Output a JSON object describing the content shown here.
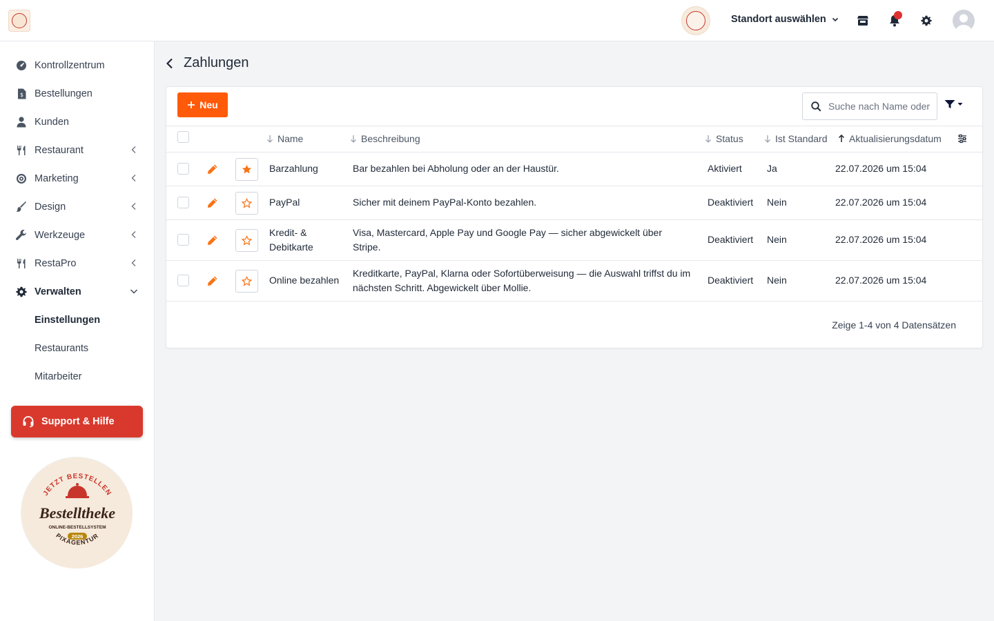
{
  "topbar": {
    "location_label": "Standort auswählen"
  },
  "sidebar": {
    "items": [
      {
        "label": "Kontrollzentrum",
        "icon": "dashboard-icon"
      },
      {
        "label": "Bestellungen",
        "icon": "invoice-icon"
      },
      {
        "label": "Kunden",
        "icon": "user-icon"
      },
      {
        "label": "Restaurant",
        "icon": "utensils-icon"
      },
      {
        "label": "Marketing",
        "icon": "target-icon"
      },
      {
        "label": "Design",
        "icon": "brush-icon"
      },
      {
        "label": "Werkzeuge",
        "icon": "wrench-icon"
      },
      {
        "label": "RestaPro",
        "icon": "utensils-icon"
      },
      {
        "label": "Verwalten",
        "icon": "gear-icon"
      }
    ],
    "sub_items": [
      "Einstellungen",
      "Restaurants",
      "Mitarbeiter"
    ],
    "support_label": "Support & Hilfe",
    "badge": {
      "top_text": "JETZT BESTELLEN",
      "brand": "Bestelltheke",
      "sub": "ONLINE-BESTELLSYSTEM",
      "year": "2026",
      "bottom_text": "PIXAGENTUR"
    }
  },
  "page": {
    "title": "Zahlungen",
    "new_label": "Neu",
    "search_placeholder": "Suche nach Name oder Beschreibung",
    "columns": {
      "name": "Name",
      "description": "Beschreibung",
      "status": "Status",
      "default": "Ist Standard",
      "updated": "Aktualisierungsdatum"
    },
    "rows": [
      {
        "name": "Barzahlung",
        "description": "Bar bezahlen bei Abholung oder an der Haustür.",
        "status": "Aktiviert",
        "default": "Ja",
        "updated": "22.07.2026 um 15:04",
        "starred": true
      },
      {
        "name": "PayPal",
        "description": "Sicher mit deinem PayPal-Konto bezahlen.",
        "status": "Deaktiviert",
        "default": "Nein",
        "updated": "22.07.2026 um 15:04",
        "starred": false
      },
      {
        "name": "Kredit- & Debitkarte",
        "description": "Visa, Mastercard, Apple Pay und Google Pay — sicher abgewickelt über Stripe.",
        "status": "Deaktiviert",
        "default": "Nein",
        "updated": "22.07.2026 um 15:04",
        "starred": false
      },
      {
        "name": "Online bezahlen",
        "description": "Kreditkarte, PayPal, Klarna oder Sofortüberweisung — die Auswahl triffst du im nächsten Schritt. Abgewickelt über Mollie.",
        "status": "Deaktiviert",
        "default": "Nein",
        "updated": "22.07.2026 um 15:04",
        "starred": false
      }
    ],
    "footer": "Zeige 1-4 von 4 Datensätzen"
  },
  "colors": {
    "accent": "#ff5a0a",
    "support": "#d9392d",
    "star": "#f97316"
  }
}
